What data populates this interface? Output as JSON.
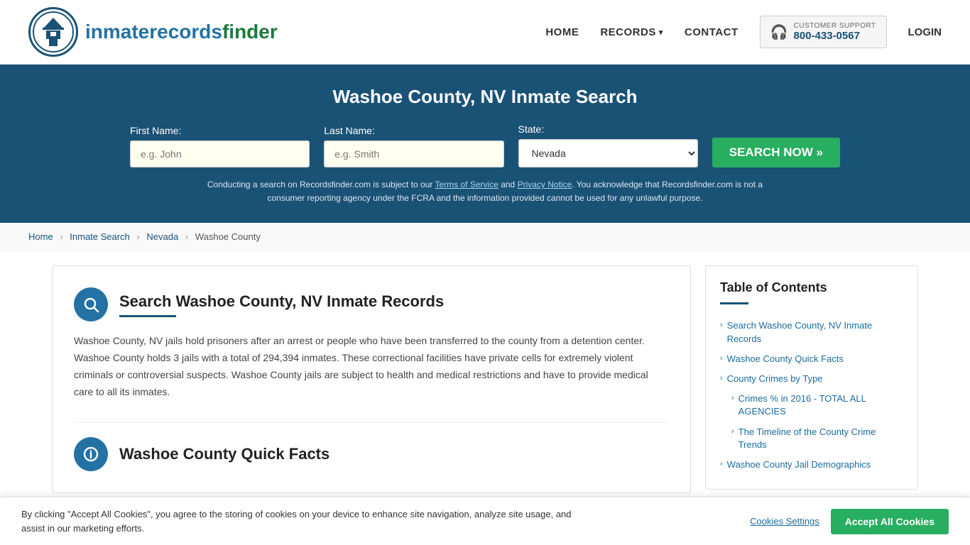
{
  "header": {
    "logo_text_normal": "inmaterecords",
    "logo_text_bold": "finder",
    "nav": {
      "home": "HOME",
      "records": "RECORDS",
      "contact": "CONTACT",
      "login": "LOGIN"
    },
    "support": {
      "label": "CUSTOMER SUPPORT",
      "phone": "800-433-0567"
    }
  },
  "search_banner": {
    "title": "Washoe County, NV Inmate Search",
    "fields": {
      "first_name_label": "First Name:",
      "first_name_placeholder": "e.g. John",
      "last_name_label": "Last Name:",
      "last_name_placeholder": "e.g. Smith",
      "state_label": "State:",
      "state_value": "Nevada"
    },
    "search_btn": "SEARCH NOW »",
    "disclaimer": "Conducting a search on Recordsfinder.com is subject to our Terms of Service and Privacy Notice. You acknowledge that Recordsfinder.com is not a consumer reporting agency under the FCRA and the information provided cannot be used for any unlawful purpose."
  },
  "breadcrumb": {
    "items": [
      "Home",
      "Inmate Search",
      "Nevada",
      "Washoe County"
    ]
  },
  "main": {
    "section1": {
      "title": "Search Washoe County, NV Inmate Records",
      "body": "Washoe County, NV jails hold prisoners after an arrest or people who have been transferred to the county from a detention center. Washoe County holds 3 jails with a total of 294,394 inmates. These correctional facilities have private cells for extremely violent criminals or controversial suspects. Washoe County jails are subject to health and medical restrictions and have to provide medical care to all its inmates."
    },
    "section2": {
      "title": "Washoe County Quick Facts"
    }
  },
  "sidebar": {
    "toc_title": "Table of Contents",
    "items": [
      {
        "label": "Search Washoe County, NV Inmate Records",
        "sub": false
      },
      {
        "label": "Washoe County Quick Facts",
        "sub": false
      },
      {
        "label": "County Crimes by Type",
        "sub": false
      },
      {
        "label": "Crimes % in 2016 - TOTAL ALL AGENCIES",
        "sub": true
      },
      {
        "label": "The Timeline of the County Crime Trends",
        "sub": true
      },
      {
        "label": "Washoe County Jail Demographics",
        "sub": false
      }
    ]
  },
  "cookie_banner": {
    "text": "By clicking \"Accept All Cookies\", you agree to the storing of cookies on your device to enhance site navigation, analyze site usage, and assist in our marketing efforts.",
    "settings_btn": "Cookies Settings",
    "accept_btn": "Accept All Cookies"
  }
}
